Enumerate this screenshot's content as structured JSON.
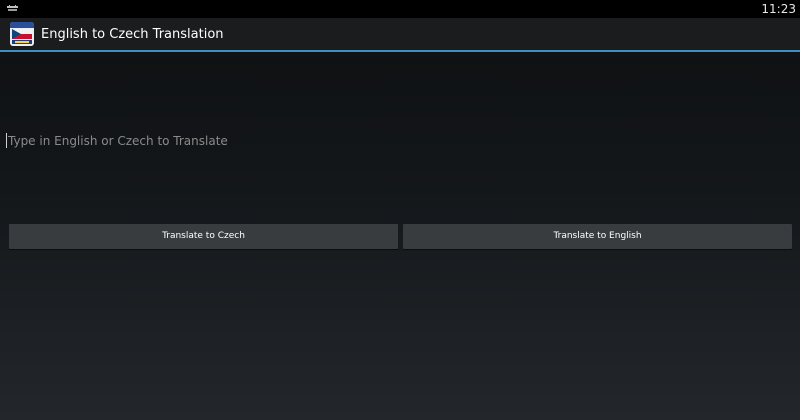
{
  "status_bar": {
    "time": "11:23",
    "notification_icon": "android-debug-icon"
  },
  "action_bar": {
    "title": "English to Czech Translation",
    "app_icon": "flag-book-icon",
    "divider_color": "#3d8fc2"
  },
  "input": {
    "value": "",
    "placeholder": "Type in English or Czech to Translate"
  },
  "buttons": {
    "to_czech_label": "Translate to Czech",
    "to_english_label": "Translate to English"
  },
  "colors": {
    "accent": "#3d8fc2",
    "button_bg": "#393c3f"
  }
}
